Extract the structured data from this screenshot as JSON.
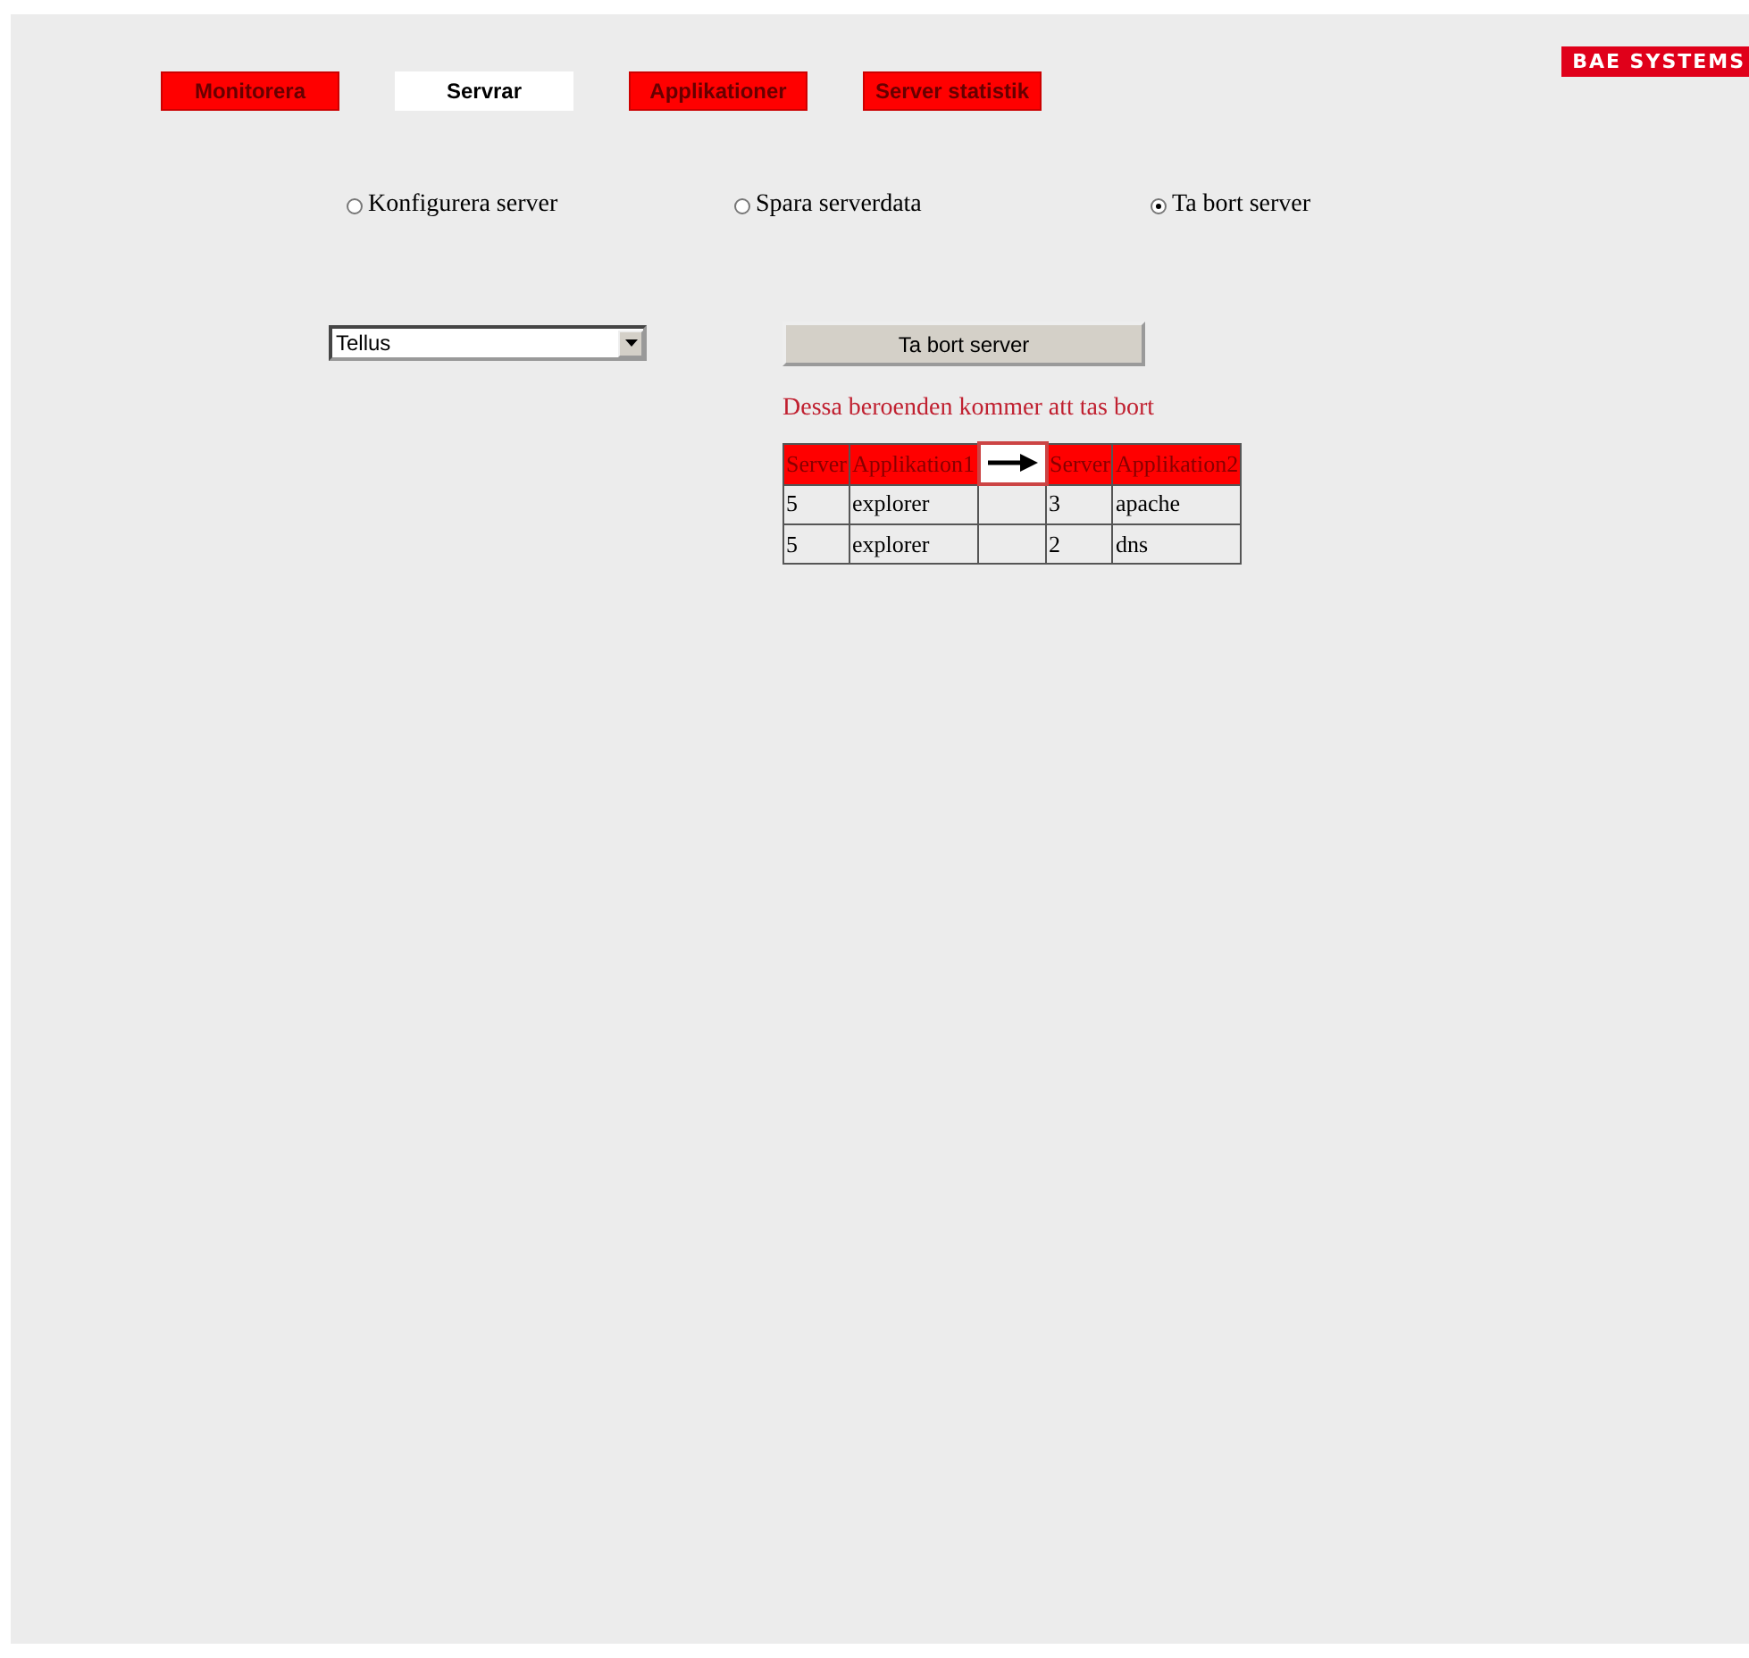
{
  "tabs": [
    {
      "label": "Monitorera",
      "selected": false
    },
    {
      "label": "Servrar",
      "selected": true
    },
    {
      "label": "Applikationer",
      "selected": false
    },
    {
      "label": "Server statistik",
      "selected": false
    }
  ],
  "logo": {
    "text": "BAE SYSTEMS"
  },
  "actions": [
    {
      "label": "Konfigurera server",
      "selected": false
    },
    {
      "label": "Spara serverdata",
      "selected": false
    },
    {
      "label": "Ta bort server",
      "selected": true
    }
  ],
  "server_select": {
    "value": "Tellus"
  },
  "delete_button": {
    "label": "Ta bort server"
  },
  "message": "Dessa beroenden kommer att tas bort",
  "table": {
    "columns": [
      {
        "kind": "text",
        "label": "Server"
      },
      {
        "kind": "text",
        "label": "Applikation1"
      },
      {
        "kind": "arrow"
      },
      {
        "kind": "text",
        "label": "Server"
      },
      {
        "kind": "text",
        "label": "Applikation2"
      }
    ],
    "rows": [
      {
        "server_1": "5",
        "application_1": "explorer",
        "server_2": "3",
        "application_2": "apache"
      },
      {
        "server_1": "5",
        "application_1": "explorer",
        "server_2": "2",
        "application_2": "dns"
      }
    ]
  }
}
